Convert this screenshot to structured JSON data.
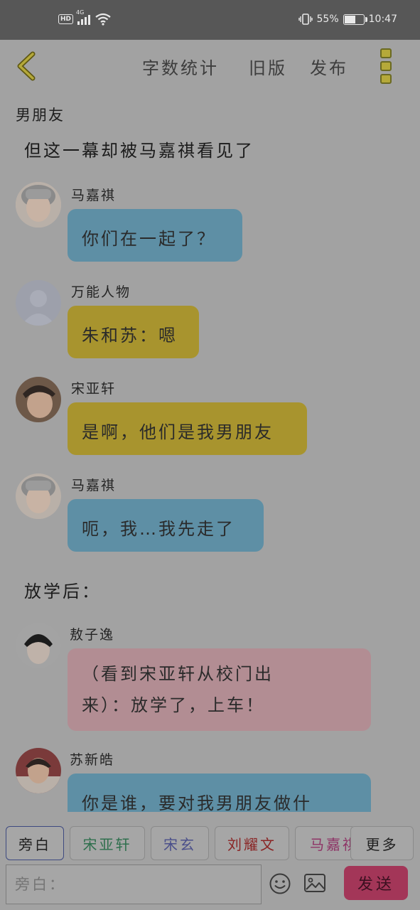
{
  "status_bar": {
    "hd": "HD",
    "network": "4G",
    "battery_percent": "55%",
    "time": "10:47",
    "battery_level": 0.55
  },
  "header": {
    "word_count": "字数统计",
    "old_version": "旧版",
    "publish": "发布"
  },
  "chat_title": "男朋友",
  "messages": {
    "top_partial": "但这一幕却被马嘉祺看见了",
    "m1": {
      "name": "马嘉祺",
      "text": "你们在一起了？"
    },
    "m2": {
      "name": "万能人物",
      "text": "朱和苏：嗯"
    },
    "m3": {
      "name": "宋亚轩",
      "text": "是啊，他们是我男朋友"
    },
    "m4": {
      "name": "马嘉祺",
      "text": "呃，我…我先走了"
    },
    "narration": "放学后：",
    "m5": {
      "name": "敖子逸",
      "line1": "（看到宋亚轩从校门出",
      "line2": "来）：放学了，上车！"
    },
    "m6": {
      "name": "苏新皓",
      "text": "你是谁，要对我男朋友做什"
    }
  },
  "roles": [
    "旁白",
    "宋亚轩",
    "宋玄",
    "刘耀文",
    "马嘉祺",
    "更多"
  ],
  "input": {
    "placeholder": "旁白："
  },
  "send_label": "发送",
  "colors": {
    "overlay_bg": "#a2a2a2",
    "bubble_blue": "#5e8fa5",
    "bubble_yellow": "#a8942e",
    "bubble_pink": "#b28d93",
    "send": "#a33658"
  }
}
